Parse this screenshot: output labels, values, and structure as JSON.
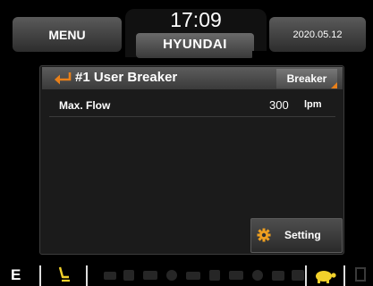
{
  "header": {
    "menu_label": "MENU",
    "time": "17:09",
    "brand": "HYUNDAI",
    "date": "2020.05.12"
  },
  "panel": {
    "title": "#1 User Breaker",
    "mode_dropdown": {
      "selected": "Breaker"
    },
    "rows": [
      {
        "label": "Max. Flow",
        "value": "300",
        "unit": "lpm"
      }
    ],
    "setting_button": {
      "label": "Setting"
    }
  },
  "status_bar": {
    "mode": "E",
    "icons": [
      "seat-icon",
      "turtle-icon"
    ]
  },
  "colors": {
    "accent_orange": "#e8801a",
    "seat_yellow": "#f2d12b",
    "turtle_yellow": "#f2d12b"
  }
}
